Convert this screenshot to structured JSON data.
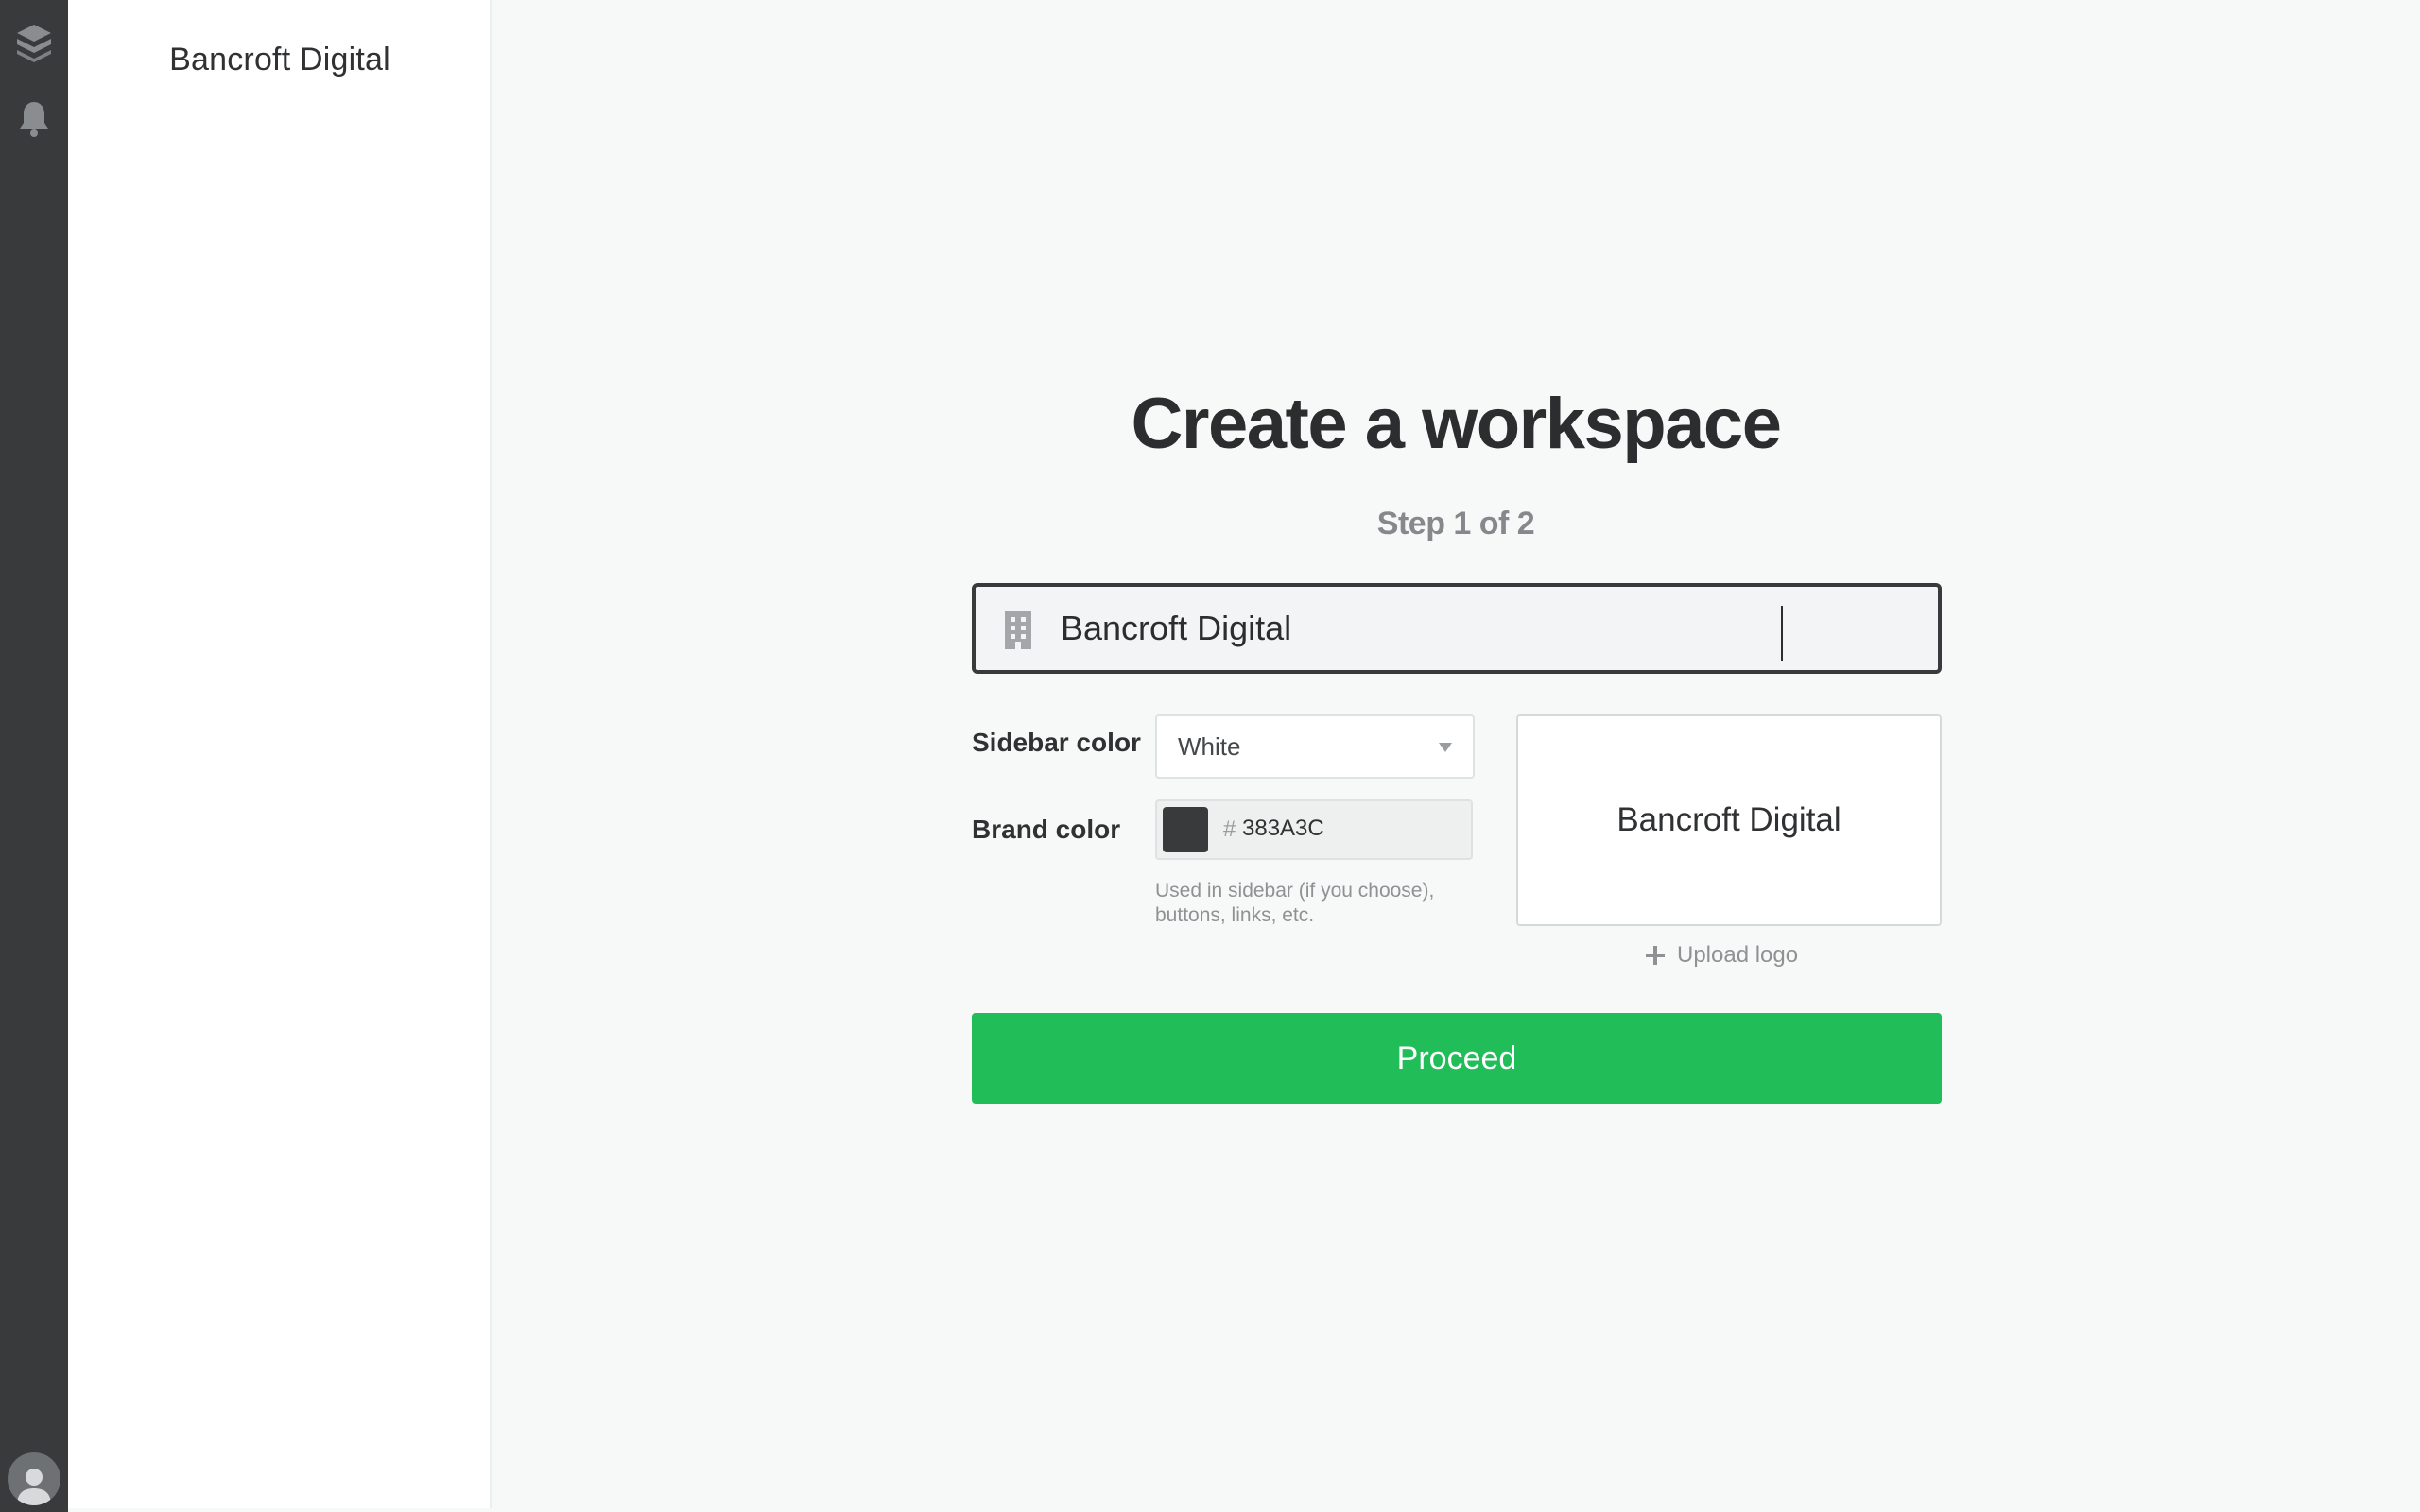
{
  "rail": {
    "icons": [
      "layers-logo-icon",
      "bell-icon",
      "user-avatar-icon"
    ],
    "background": "#383A3C"
  },
  "sidebar": {
    "title": "Bancroft Digital"
  },
  "main": {
    "title": "Create a workspace",
    "step": "Step 1 of 2",
    "workspace_name": {
      "value": "Bancroft Digital",
      "icon": "building-icon"
    },
    "sidebar_color": {
      "label": "Sidebar color",
      "selected": "White"
    },
    "brand_color": {
      "label": "Brand color",
      "hash": "#",
      "value": "383A3C",
      "swatch": "#383A3C",
      "helper": "Used in sidebar (if you choose), buttons, links, etc."
    },
    "preview": {
      "title": "Bancroft Digital"
    },
    "upload_logo": "Upload logo",
    "proceed": "Proceed"
  },
  "colors": {
    "accent": "#21BD59",
    "rail": "#383A3C",
    "background": "#F7F8F8"
  }
}
